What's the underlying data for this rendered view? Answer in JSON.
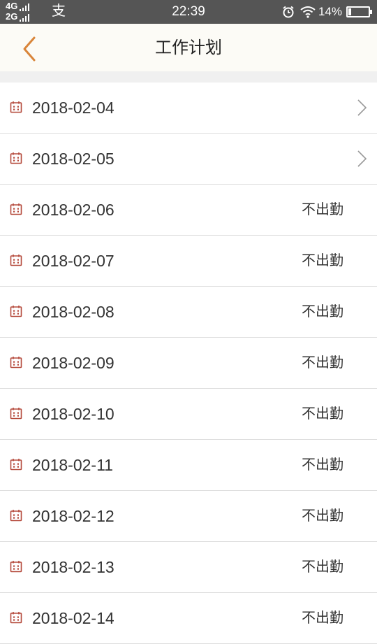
{
  "status_bar": {
    "net_top": "4G",
    "net_bottom": "2G",
    "alipay_glyph": "支",
    "time": "22:39",
    "battery_pct": "14%",
    "battery_level": 0.14,
    "icons": [
      "signal-icon",
      "alipay-icon",
      "alarm-icon",
      "wifi-icon",
      "battery-icon"
    ]
  },
  "header": {
    "title": "工作计划",
    "back_icon": "back-chevron-icon",
    "accent_color": "#d9853a"
  },
  "plans": [
    {
      "date": "2018-02-04",
      "status": "",
      "has_arrow": true
    },
    {
      "date": "2018-02-05",
      "status": "",
      "has_arrow": true
    },
    {
      "date": "2018-02-06",
      "status": "不出勤",
      "has_arrow": false
    },
    {
      "date": "2018-02-07",
      "status": "不出勤",
      "has_arrow": false
    },
    {
      "date": "2018-02-08",
      "status": "不出勤",
      "has_arrow": false
    },
    {
      "date": "2018-02-09",
      "status": "不出勤",
      "has_arrow": false
    },
    {
      "date": "2018-02-10",
      "status": "不出勤",
      "has_arrow": false
    },
    {
      "date": "2018-02-11",
      "status": "不出勤",
      "has_arrow": false
    },
    {
      "date": "2018-02-12",
      "status": "不出勤",
      "has_arrow": false
    },
    {
      "date": "2018-02-13",
      "status": "不出勤",
      "has_arrow": false
    },
    {
      "date": "2018-02-14",
      "status": "不出勤",
      "has_arrow": false
    }
  ],
  "colors": {
    "calendar_icon": "#b54a3c",
    "chevron": "#9a9a9a",
    "status_bar_bg": "#555555",
    "nav_bg": "#fcfbf6"
  }
}
